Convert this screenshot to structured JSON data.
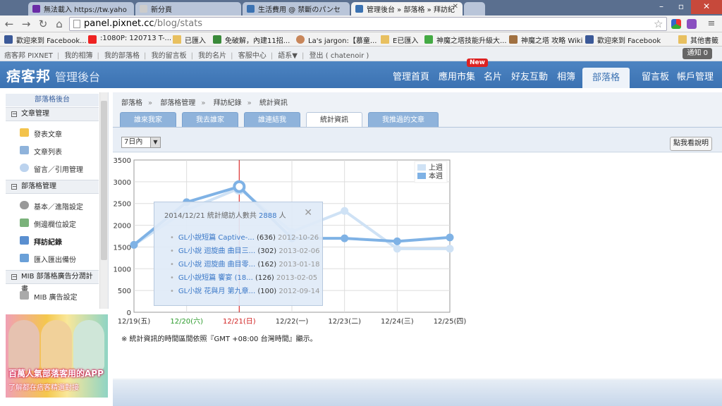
{
  "browser": {
    "tabs": [
      {
        "label": "無法載入 https://tw.yaho",
        "icon_color": "#6a2ba6"
      },
      {
        "label": "新分頁",
        "icon_color": "#cccccc"
      },
      {
        "label": "生活費用 @ 禁斷のパンセ",
        "icon_color": "#3b72b2"
      },
      {
        "label": "管理後台 » 部落格 » 拜訪紀",
        "icon_color": "#3b72b2"
      }
    ],
    "url_host": "panel.pixnet.cc",
    "url_path": "/blog/stats",
    "bookmarks": [
      {
        "label": "歡迎來到 Facebook...",
        "icon": "facebook-icon"
      },
      {
        "label": ":1080P: 120713 T-...",
        "icon": "youtube-icon"
      },
      {
        "label": "已匯入",
        "icon": "folder-icon"
      },
      {
        "label": "免破解，內建11招...",
        "icon": "bookmark-icon"
      },
      {
        "label": "La's jargon:【慕童...",
        "icon": "avatar-icon"
      },
      {
        "label": "E已匯入",
        "icon": "folder-icon"
      },
      {
        "label": "神魔之塔技能升級大...",
        "icon": "bookmark-icon"
      },
      {
        "label": "神魔之塔 攻略 Wiki",
        "icon": "bookmark-icon"
      },
      {
        "label": "歡迎來到 Facebook",
        "icon": "facebook-icon"
      },
      {
        "label": "其他書籤",
        "icon": "folder-icon"
      }
    ]
  },
  "pixnet_links": [
    "痞客邦 PIXNET",
    "我的相簿",
    "我的部落格",
    "我的留言板",
    "我的名片",
    "客服中心",
    "語系▼",
    "登出 ( chatenoir )"
  ],
  "notify": "通知 0",
  "header": {
    "logo": "痞客邦",
    "admin_title": "管理後台",
    "nav": [
      "管理首頁",
      "應用市集",
      "名片",
      "好友互動",
      "相簿",
      "部落格",
      "留言板",
      "帳戶管理"
    ],
    "active_nav": "部落格",
    "new_badge": "New"
  },
  "sidebar": {
    "title": "部落格後台",
    "sections": [
      {
        "label": "文章管理",
        "items": [
          "發表文章",
          "文章列表",
          "留言／引用管理"
        ]
      },
      {
        "label": "部落格管理",
        "items": [
          "基本／進階設定",
          "側邊欄位設定",
          "拜訪紀錄",
          "匯入匯出備份"
        ]
      },
      {
        "label": "MIB 部落格廣告分潤計畫",
        "items": [
          "MIB 廣告設定"
        ]
      }
    ],
    "current": "拜訪紀錄",
    "promo_text": "百萬人氣部落客用的APP",
    "promo_sub": "了解都在痞客精選對接"
  },
  "content": {
    "breadcrumb": [
      "部落格",
      "部落格管理",
      "拜訪紀錄",
      "統計資訊"
    ],
    "tabs": [
      "誰來我家",
      "我去誰家",
      "誰連結我",
      "統計資訊",
      "我推過的文章"
    ],
    "active_tab": "統計資訊",
    "range_select": "7日內",
    "help_button": "點我看說明",
    "note": "※ 統計資訊的時間區間依照『GMT +08:00 台灣時間』顯示。"
  },
  "popup": {
    "title_prefix": "2014/12/21 統計總訪人數共",
    "count": "2888",
    "title_suffix": "人",
    "rows": [
      {
        "title": "GL小說短篇 Captive-...",
        "count": "(636)",
        "date": "2012-10-26"
      },
      {
        "title": "GL小說 迴旋曲 曲目三...",
        "count": "(302)",
        "date": "2013-02-06"
      },
      {
        "title": "GL小說 迴旋曲 曲目零...",
        "count": "(162)",
        "date": "2013-01-18"
      },
      {
        "title": "GL小說短篇 饗宴 (18...",
        "count": "(126)",
        "date": "2013-02-05"
      },
      {
        "title": "GL小說 花與月 第九章...",
        "count": "(100)",
        "date": "2012-09-14"
      }
    ]
  },
  "colors": {
    "this_week": "#7fb2e5",
    "last_week": "#cfe2f5",
    "weekend_sat": "#2a9a2a",
    "weekend_sun": "#d02020"
  },
  "chart_data": {
    "type": "line",
    "categories": [
      "12/19(五)",
      "12/20(六)",
      "12/21(日)",
      "12/22(一)",
      "12/23(二)",
      "12/24(三)",
      "12/25(四)"
    ],
    "series": [
      {
        "name": "上週",
        "values": [
          1550,
          2350,
          2850,
          1850,
          2330,
          1460,
          1460
        ]
      },
      {
        "name": "本週",
        "values": [
          1550,
          2530,
          2888,
          1700,
          1700,
          1630,
          1720
        ]
      }
    ],
    "yticks": [
      0,
      500,
      1000,
      1500,
      2000,
      2500,
      3000,
      3500
    ],
    "ylim": [
      0,
      3500
    ],
    "grid": true,
    "legend": "top-right",
    "highlight": "12/21(日)"
  }
}
